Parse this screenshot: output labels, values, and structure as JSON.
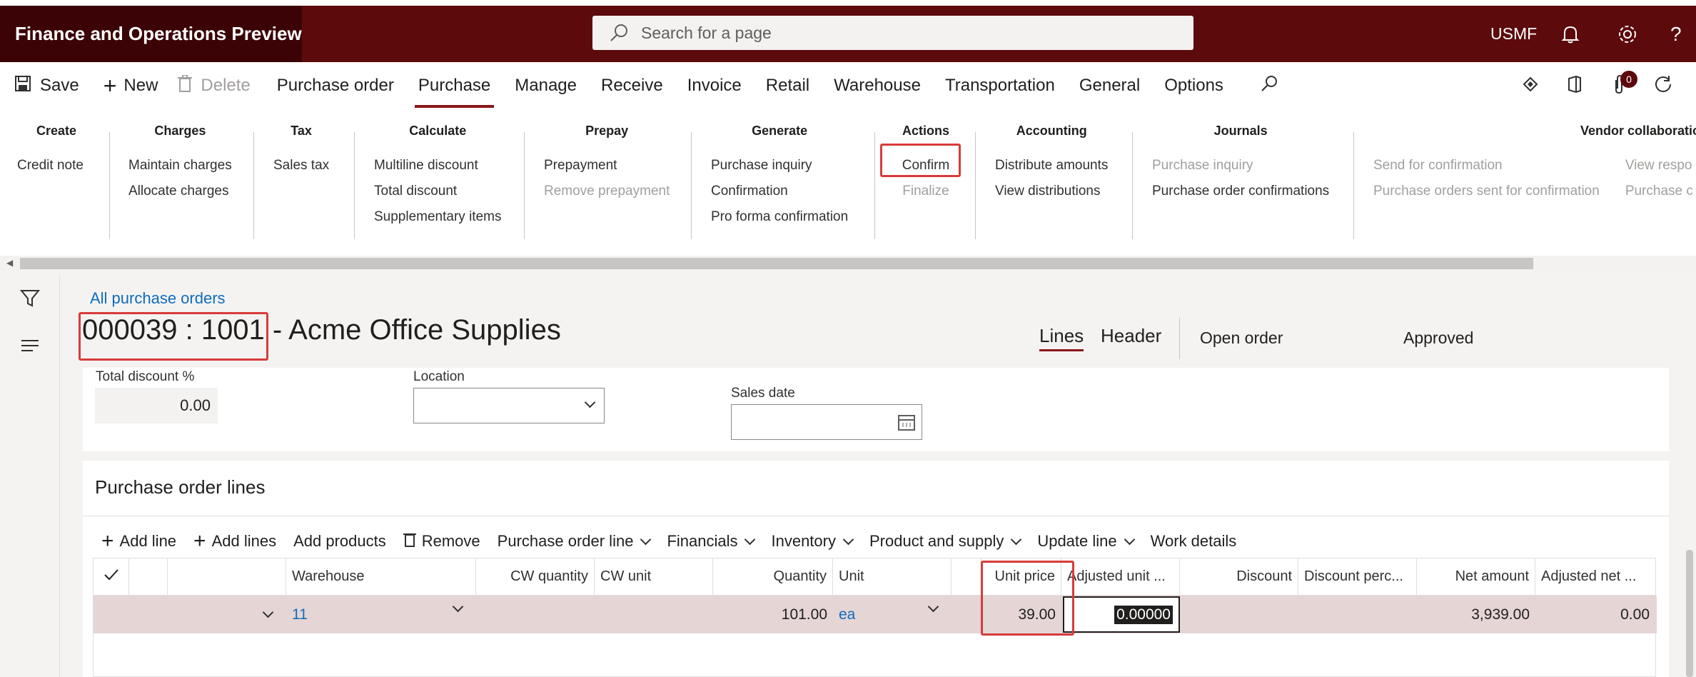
{
  "app": {
    "title": "Finance and Operations Preview",
    "search_placeholder": "Search for a page",
    "company": "USMF",
    "attach_count": "0"
  },
  "toolbar": {
    "save": "Save",
    "new": "New",
    "delete": "Delete",
    "tabs": [
      "Purchase order",
      "Purchase",
      "Manage",
      "Receive",
      "Invoice",
      "Retail",
      "Warehouse",
      "Transportation",
      "General",
      "Options"
    ]
  },
  "ribbon": {
    "create": {
      "title": "Create",
      "items": [
        "Credit note"
      ]
    },
    "charges": {
      "title": "Charges",
      "items": [
        "Maintain charges",
        "Allocate charges"
      ]
    },
    "tax": {
      "title": "Tax",
      "items": [
        "Sales tax"
      ]
    },
    "calculate": {
      "title": "Calculate",
      "items": [
        "Multiline discount",
        "Total discount",
        "Supplementary items"
      ]
    },
    "prepay": {
      "title": "Prepay",
      "items": [
        "Prepayment",
        "Remove prepayment"
      ]
    },
    "generate": {
      "title": "Generate",
      "items": [
        "Purchase inquiry",
        "Confirmation",
        "Pro forma confirmation"
      ]
    },
    "actions": {
      "title": "Actions",
      "items": [
        "Confirm",
        "Finalize"
      ]
    },
    "accounting": {
      "title": "Accounting",
      "items": [
        "Distribute amounts",
        "View distributions"
      ]
    },
    "journals": {
      "title": "Journals",
      "items": [
        "Purchase inquiry",
        "Purchase order confirmations"
      ]
    },
    "vendor": {
      "title": "Vendor collaboration",
      "items": [
        "Send for confirmation",
        "Purchase orders sent for confirmation",
        "View respo",
        "Purchase c"
      ]
    }
  },
  "page": {
    "breadcrumb": "All purchase orders",
    "order_id": "000039 : 1001",
    "title_rest": " - Acme Office Supplies",
    "view_tabs": [
      "Lines",
      "Header"
    ],
    "order_status": "Open order",
    "approval_status": "Approved"
  },
  "header_fields": {
    "total_discount_label": "Total discount %",
    "total_discount_value": "0.00",
    "location_label": "Location",
    "sales_date_label": "Sales date"
  },
  "lines": {
    "section_title": "Purchase order lines",
    "buttons": [
      "Add line",
      "Add lines",
      "Add products",
      "Remove",
      "Purchase order line",
      "Financials",
      "Inventory",
      "Product and supply",
      "Update line",
      "Work details"
    ],
    "columns": [
      "Warehouse",
      "CW quantity",
      "CW unit",
      "Quantity",
      "Unit",
      "Unit price",
      "Adjusted unit ...",
      "Discount",
      "Discount perc...",
      "Net amount",
      "Adjusted net ..."
    ],
    "rows": [
      {
        "warehouse": "11",
        "cw_quantity": "",
        "cw_unit": "",
        "quantity": "101.00",
        "unit": "ea",
        "unit_price": "39.00",
        "adjusted_unit": "0.00000",
        "discount": "",
        "discount_pct": "",
        "net_amount": "3,939.00",
        "adjusted_net": "0.00"
      }
    ]
  }
}
